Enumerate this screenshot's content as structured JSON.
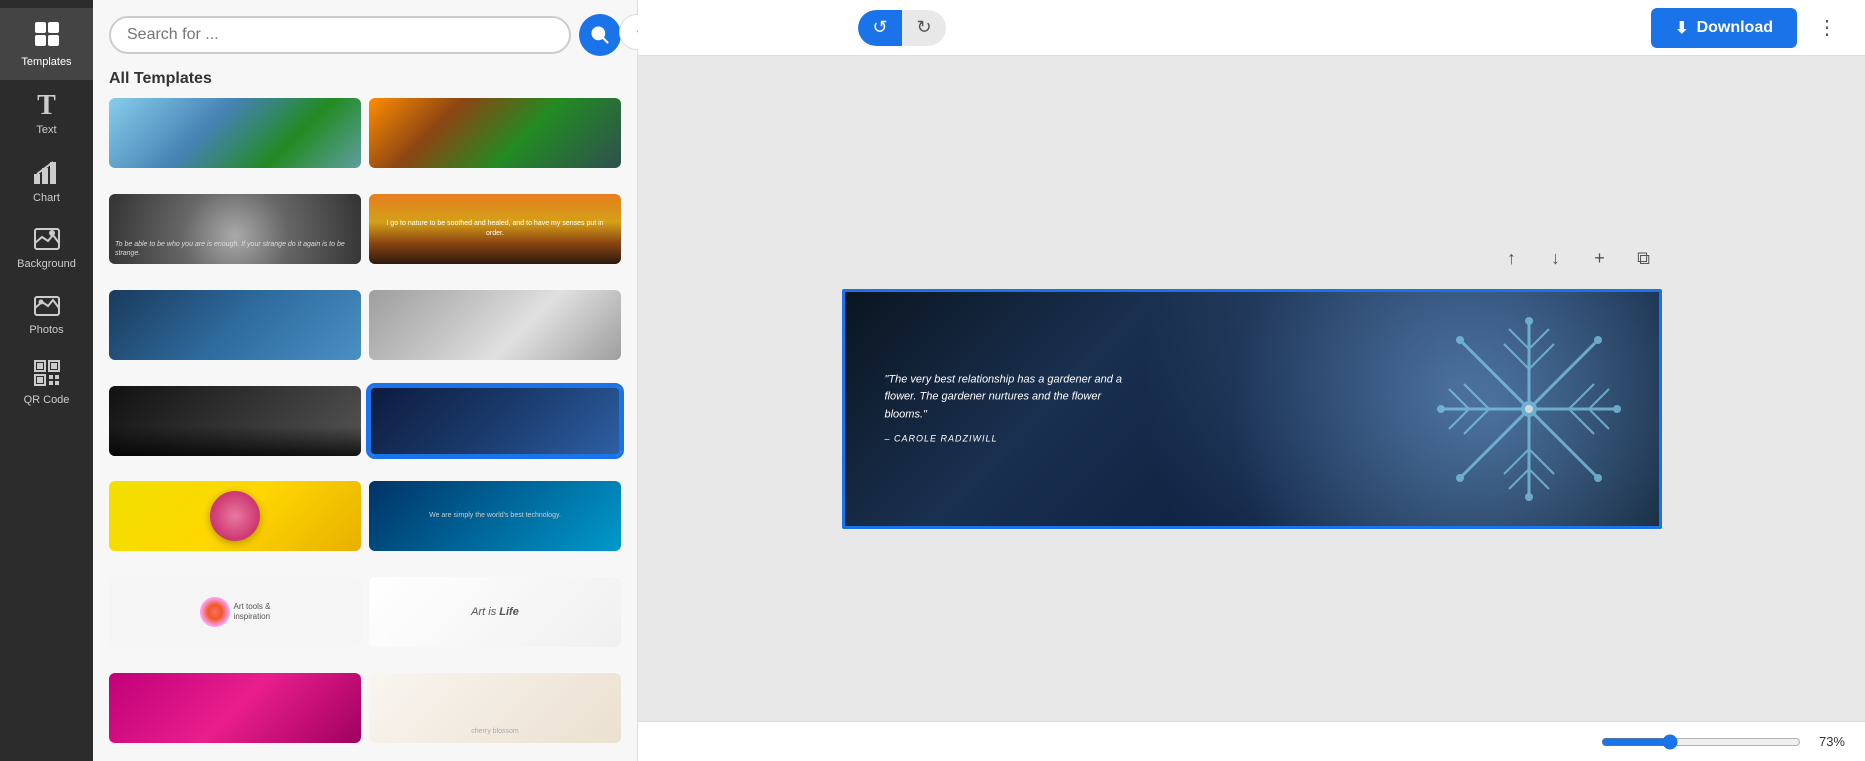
{
  "sidebar": {
    "items": [
      {
        "id": "templates",
        "label": "Templates",
        "icon": "⊞",
        "active": true
      },
      {
        "id": "text",
        "label": "Text",
        "icon": "T"
      },
      {
        "id": "chart",
        "label": "Chart",
        "icon": "📊"
      },
      {
        "id": "background",
        "label": "Background",
        "icon": "🖼"
      },
      {
        "id": "photos",
        "label": "Photos",
        "icon": "🏔"
      },
      {
        "id": "qrcode",
        "label": "QR Code",
        "icon": "▩"
      }
    ]
  },
  "search": {
    "placeholder": "Search for ...",
    "button_label": "Search"
  },
  "panel": {
    "title": "All Templates",
    "templates_count": 14
  },
  "toolbar": {
    "undo_label": "↺",
    "redo_label": "↻",
    "download_label": "Download",
    "more_label": "⋮"
  },
  "canvas": {
    "quote_main": "\"The very best relationship has a gardener and a flower. The gardener nurtures and the flower blooms.\"",
    "quote_attr": "– CAROLE RADZIWILL",
    "controls": {
      "up": "↑",
      "down": "↓",
      "add": "+",
      "copy": "⧉"
    }
  },
  "zoom": {
    "value": 73,
    "label": "73%",
    "min": 10,
    "max": 200
  }
}
